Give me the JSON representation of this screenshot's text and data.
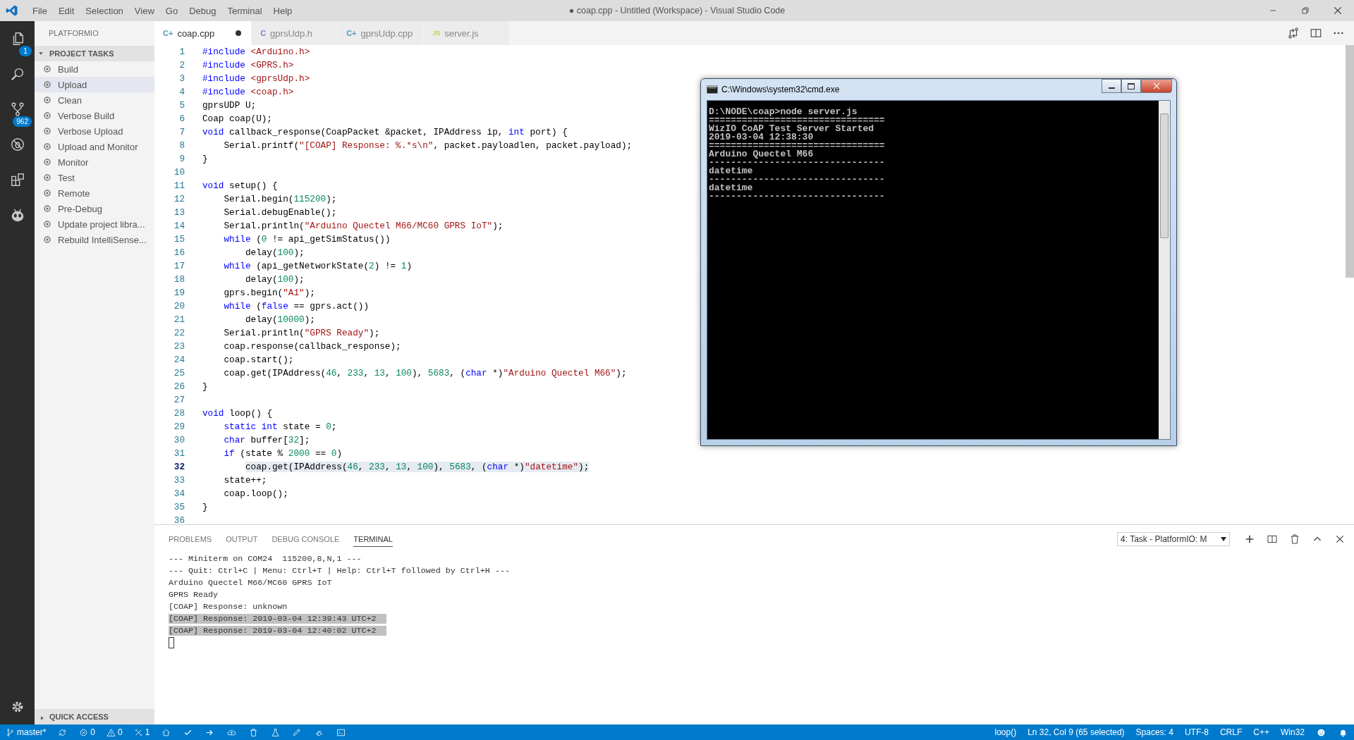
{
  "window": {
    "title": "● coap.cpp - Untitled (Workspace) - Visual Studio Code",
    "menu": [
      "File",
      "Edit",
      "Selection",
      "View",
      "Go",
      "Debug",
      "Terminal",
      "Help"
    ]
  },
  "activity_bar": [
    {
      "kind": "explorer",
      "badge": "1"
    },
    {
      "kind": "search"
    },
    {
      "kind": "source-control",
      "badge": "962"
    },
    {
      "kind": "debug"
    },
    {
      "kind": "extensions"
    },
    {
      "kind": "platformio"
    }
  ],
  "sidebar": {
    "title": "PLATFORMIO",
    "sections": [
      {
        "title": "PROJECT TASKS",
        "expanded": true,
        "items": [
          {
            "label": "Build",
            "selected": false
          },
          {
            "label": "Upload",
            "selected": true
          },
          {
            "label": "Clean",
            "selected": false
          },
          {
            "label": "Verbose Build",
            "selected": false
          },
          {
            "label": "Verbose Upload",
            "selected": false
          },
          {
            "label": "Upload and Monitor",
            "selected": false
          },
          {
            "label": "Monitor",
            "selected": false
          },
          {
            "label": "Test",
            "selected": false
          },
          {
            "label": "Remote",
            "selected": false
          },
          {
            "label": "Pre-Debug",
            "selected": false
          },
          {
            "label": "Update project libra...",
            "selected": false
          },
          {
            "label": "Rebuild IntelliSense...",
            "selected": false
          }
        ]
      },
      {
        "title": "QUICK ACCESS",
        "expanded": false
      }
    ]
  },
  "tabs": [
    {
      "label": "coap.cpp",
      "kind": "cpp",
      "icon_text": "C+",
      "selected": true,
      "modified": true
    },
    {
      "label": "gprsUdp.h",
      "kind": "c",
      "icon_text": "C",
      "selected": false,
      "modified": false
    },
    {
      "label": "gprsUdp.cpp",
      "kind": "cpp",
      "icon_text": "C+",
      "selected": false,
      "modified": false
    },
    {
      "label": "server.js",
      "kind": "js",
      "icon_text": "JS",
      "selected": false,
      "modified": false
    }
  ],
  "editor": {
    "lines": [
      {
        "number": "1",
        "selected": false,
        "tokens": [
          {
            "kind": "kw",
            "text": "#include"
          },
          {
            "kind": "str",
            "text": " <Arduino.h>"
          }
        ]
      },
      {
        "number": "2",
        "selected": false,
        "tokens": [
          {
            "kind": "kw",
            "text": "#include"
          },
          {
            "kind": "str",
            "text": " <GPRS.h>"
          }
        ]
      },
      {
        "number": "3",
        "selected": false,
        "tokens": [
          {
            "kind": "kw",
            "text": "#include"
          },
          {
            "kind": "str",
            "text": " <gprsUdp.h>"
          }
        ]
      },
      {
        "number": "4",
        "selected": false,
        "tokens": [
          {
            "kind": "kw",
            "text": "#include"
          },
          {
            "kind": "str",
            "text": " <coap.h>"
          }
        ]
      },
      {
        "number": "5",
        "selected": false,
        "tokens": [
          {
            "kind": "txt",
            "text": "gprsUDP U;"
          }
        ]
      },
      {
        "number": "6",
        "selected": false,
        "tokens": [
          {
            "kind": "txt",
            "text": "Coap coap(U);"
          }
        ]
      },
      {
        "number": "7",
        "selected": false,
        "tokens": [
          {
            "kind": "kw",
            "text": "void"
          },
          {
            "kind": "txt",
            "text": " callback_response(CoapPacket &packet, IPAddress ip, "
          },
          {
            "kind": "kw",
            "text": "int"
          },
          {
            "kind": "txt",
            "text": " port) {"
          }
        ]
      },
      {
        "number": "8",
        "selected": false,
        "tokens": [
          {
            "kind": "txt",
            "text": "    Serial.printf("
          },
          {
            "kind": "str",
            "text": "\"[COAP] Response: %.*s\\n\""
          },
          {
            "kind": "txt",
            "text": ", packet.payloadlen, packet.payload);"
          }
        ]
      },
      {
        "number": "9",
        "selected": false,
        "tokens": [
          {
            "kind": "txt",
            "text": "}"
          }
        ]
      },
      {
        "number": "10",
        "selected": false
      },
      {
        "number": "11",
        "selected": false,
        "tokens": [
          {
            "kind": "kw",
            "text": "void"
          },
          {
            "kind": "txt",
            "text": " setup() {"
          }
        ]
      },
      {
        "number": "12",
        "selected": false,
        "tokens": [
          {
            "kind": "txt",
            "text": "    Serial.begin("
          },
          {
            "kind": "num",
            "text": "115200"
          },
          {
            "kind": "txt",
            "text": ");"
          }
        ]
      },
      {
        "number": "13",
        "selected": false,
        "tokens": [
          {
            "kind": "txt",
            "text": "    Serial.debugEnable();"
          }
        ]
      },
      {
        "number": "14",
        "selected": false,
        "tokens": [
          {
            "kind": "txt",
            "text": "    Serial.println("
          },
          {
            "kind": "str",
            "text": "\"Arduino Quectel M66/MC60 GPRS IoT\""
          },
          {
            "kind": "txt",
            "text": ");"
          }
        ]
      },
      {
        "number": "15",
        "selected": false,
        "tokens": [
          {
            "kind": "kw",
            "text": "    while"
          },
          {
            "kind": "txt",
            "text": " ("
          },
          {
            "kind": "num",
            "text": "0"
          },
          {
            "kind": "txt",
            "text": " != api_getSimStatus())"
          }
        ]
      },
      {
        "number": "16",
        "selected": false,
        "tokens": [
          {
            "kind": "txt",
            "text": "        delay("
          },
          {
            "kind": "num",
            "text": "100"
          },
          {
            "kind": "txt",
            "text": ");"
          }
        ]
      },
      {
        "number": "17",
        "selected": false,
        "tokens": [
          {
            "kind": "kw",
            "text": "    while"
          },
          {
            "kind": "txt",
            "text": " (api_getNetworkState("
          },
          {
            "kind": "num",
            "text": "2"
          },
          {
            "kind": "txt",
            "text": ") != "
          },
          {
            "kind": "num",
            "text": "1"
          },
          {
            "kind": "txt",
            "text": ")"
          }
        ]
      },
      {
        "number": "18",
        "selected": false,
        "tokens": [
          {
            "kind": "txt",
            "text": "        delay("
          },
          {
            "kind": "num",
            "text": "100"
          },
          {
            "kind": "txt",
            "text": ");"
          }
        ]
      },
      {
        "number": "19",
        "selected": false,
        "tokens": [
          {
            "kind": "txt",
            "text": "    gprs.begin("
          },
          {
            "kind": "str",
            "text": "\"A1\""
          },
          {
            "kind": "txt",
            "text": ");"
          }
        ]
      },
      {
        "number": "20",
        "selected": false,
        "tokens": [
          {
            "kind": "kw",
            "text": "    while"
          },
          {
            "kind": "txt",
            "text": " ("
          },
          {
            "kind": "kw",
            "text": "false"
          },
          {
            "kind": "txt",
            "text": " == gprs.act())"
          }
        ]
      },
      {
        "number": "21",
        "selected": false,
        "tokens": [
          {
            "kind": "txt",
            "text": "        delay("
          },
          {
            "kind": "num",
            "text": "10000"
          },
          {
            "kind": "txt",
            "text": ");"
          }
        ]
      },
      {
        "number": "22",
        "selected": false,
        "tokens": [
          {
            "kind": "txt",
            "text": "    Serial.println("
          },
          {
            "kind": "str",
            "text": "\"GPRS Ready\""
          },
          {
            "kind": "txt",
            "text": ");"
          }
        ]
      },
      {
        "number": "23",
        "selected": false,
        "tokens": [
          {
            "kind": "txt",
            "text": "    coap.response(callback_response);"
          }
        ]
      },
      {
        "number": "24",
        "selected": false,
        "tokens": [
          {
            "kind": "txt",
            "text": "    coap.start();"
          }
        ]
      },
      {
        "number": "25",
        "selected": false,
        "tokens": [
          {
            "kind": "txt",
            "text": "    coap.get(IPAddress("
          },
          {
            "kind": "num",
            "text": "46"
          },
          {
            "kind": "txt",
            "text": ", "
          },
          {
            "kind": "num",
            "text": "233"
          },
          {
            "kind": "txt",
            "text": ", "
          },
          {
            "kind": "num",
            "text": "13"
          },
          {
            "kind": "txt",
            "text": ", "
          },
          {
            "kind": "num",
            "text": "100"
          },
          {
            "kind": "txt",
            "text": "), "
          },
          {
            "kind": "num",
            "text": "5683"
          },
          {
            "kind": "txt",
            "text": ", ("
          },
          {
            "kind": "kw",
            "text": "char"
          },
          {
            "kind": "txt",
            "text": " *)"
          },
          {
            "kind": "str",
            "text": "\"Arduino Quectel M66\""
          },
          {
            "kind": "txt",
            "text": ");"
          }
        ]
      },
      {
        "number": "26",
        "selected": false,
        "tokens": [
          {
            "kind": "txt",
            "text": "}"
          }
        ]
      },
      {
        "number": "27",
        "selected": false
      },
      {
        "number": "28",
        "selected": false,
        "tokens": [
          {
            "kind": "kw",
            "text": "void"
          },
          {
            "kind": "txt",
            "text": " loop() {"
          }
        ]
      },
      {
        "number": "29",
        "selected": false,
        "tokens": [
          {
            "kind": "kw",
            "text": "    static int"
          },
          {
            "kind": "txt",
            "text": " state = "
          },
          {
            "kind": "num",
            "text": "0"
          },
          {
            "kind": "txt",
            "text": ";"
          }
        ]
      },
      {
        "number": "30",
        "selected": false,
        "tokens": [
          {
            "kind": "kw",
            "text": "    char"
          },
          {
            "kind": "txt",
            "text": " buffer["
          },
          {
            "kind": "num",
            "text": "32"
          },
          {
            "kind": "txt",
            "text": "];"
          }
        ]
      },
      {
        "number": "31",
        "selected": false,
        "tokens": [
          {
            "kind": "kw",
            "text": "    if"
          },
          {
            "kind": "txt",
            "text": " (state % "
          },
          {
            "kind": "num",
            "text": "2000"
          },
          {
            "kind": "txt",
            "text": " == "
          },
          {
            "kind": "num",
            "text": "0"
          },
          {
            "kind": "txt",
            "text": ")"
          }
        ]
      },
      {
        "number": "32",
        "selected": true,
        "tokens": [
          {
            "kind": "txt",
            "text": "        coap.get(IPAddress("
          },
          {
            "kind": "num",
            "text": "46"
          },
          {
            "kind": "txt",
            "text": ", "
          },
          {
            "kind": "num",
            "text": "233"
          },
          {
            "kind": "txt",
            "text": ", "
          },
          {
            "kind": "num",
            "text": "13"
          },
          {
            "kind": "txt",
            "text": ", "
          },
          {
            "kind": "num",
            "text": "100"
          },
          {
            "kind": "txt",
            "text": "), "
          },
          {
            "kind": "num",
            "text": "5683"
          },
          {
            "kind": "txt",
            "text": ", ("
          },
          {
            "kind": "kw",
            "text": "char"
          },
          {
            "kind": "txt",
            "text": " *)"
          },
          {
            "kind": "str",
            "text": "\"datetime\""
          },
          {
            "kind": "txt",
            "text": ");"
          }
        ]
      },
      {
        "number": "33",
        "selected": false,
        "tokens": [
          {
            "kind": "txt",
            "text": "    state++;"
          }
        ]
      },
      {
        "number": "34",
        "selected": false,
        "tokens": [
          {
            "kind": "txt",
            "text": "    coap.loop();"
          }
        ]
      },
      {
        "number": "35",
        "selected": false,
        "tokens": [
          {
            "kind": "txt",
            "text": "}"
          }
        ]
      },
      {
        "number": "36",
        "selected": false
      }
    ]
  },
  "cmd_window": {
    "title": "C:\\Windows\\system32\\cmd.exe",
    "lines": [
      "D:\\NODE\\coap>node server.js",
      "================================",
      "WizIO CoAP Test Server Started",
      "2019-03-04 12:38:30",
      "================================",
      "Arduino Quectel M66",
      "--------------------------------",
      "datetime",
      "--------------------------------",
      "datetime",
      "--------------------------------"
    ]
  },
  "panel": {
    "tabs": [
      {
        "label": "PROBLEMS",
        "selected": false
      },
      {
        "label": "OUTPUT",
        "selected": false
      },
      {
        "label": "DEBUG CONSOLE",
        "selected": false
      },
      {
        "label": "TERMINAL",
        "selected": true
      }
    ],
    "terminal_picker": "4: Task - PlatformIO: M",
    "lines": [
      {
        "text": "--- Miniterm on COM24  115200,8,N,1 ---",
        "selected": false
      },
      {
        "text": "--- Quit: Ctrl+C | Menu: Ctrl+T | Help: Ctrl+T followed by Ctrl+H ---",
        "selected": false
      },
      {
        "text": "Arduino Quectel M66/MC60 GPRS IoT",
        "selected": false
      },
      {
        "text": "GPRS Ready",
        "selected": false
      },
      {
        "text": "[COAP] Response: unknown",
        "selected": false
      },
      {
        "text": "[COAP] Response: 2019-03-04 12:39:43 UTC+2",
        "selected": true
      },
      {
        "text": "[COAP] Response: 2019-03-04 12:40:02 UTC+2",
        "selected": true
      }
    ]
  },
  "status_bar": {
    "left": [
      {
        "kind": "branch",
        "text": "master*"
      },
      {
        "kind": "sync"
      },
      {
        "kind": "errors",
        "text": "0"
      },
      {
        "kind": "warnings",
        "text": "0"
      },
      {
        "kind": "tasks",
        "text": "1"
      }
    ],
    "right": [
      "loop()",
      "Ln 32, Col 9 (65 selected)",
      "Spaces: 4",
      "UTF-8",
      "CRLF",
      "C++",
      "Win32"
    ]
  }
}
